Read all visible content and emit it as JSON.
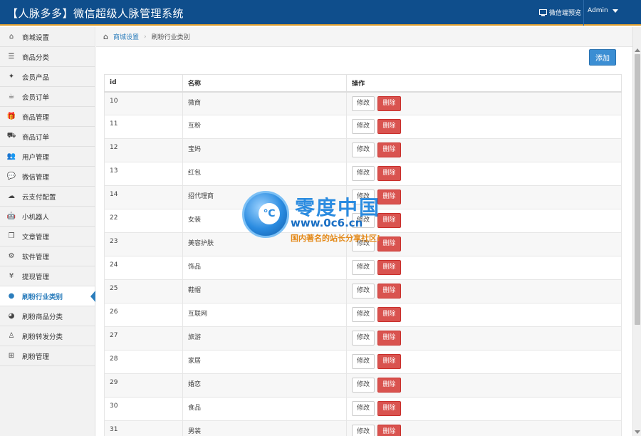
{
  "header": {
    "title": "【人脉多多】微信超级人脉管理系统",
    "preview_label": "微信端预览",
    "user": "Admin"
  },
  "sidebar": {
    "items": [
      {
        "label": "商城设置",
        "icon": "home-icon",
        "glyph": "⌂"
      },
      {
        "label": "商品分类",
        "icon": "list-icon",
        "glyph": "☰"
      },
      {
        "label": "会员产品",
        "icon": "twitter-icon",
        "glyph": "✦"
      },
      {
        "label": "会员订单",
        "icon": "coffee-icon",
        "glyph": "☕"
      },
      {
        "label": "商品管理",
        "icon": "gift-icon",
        "glyph": "🎁"
      },
      {
        "label": "商品订单",
        "icon": "truck-icon",
        "glyph": "⛟"
      },
      {
        "label": "用户管理",
        "icon": "users-icon",
        "glyph": "👥"
      },
      {
        "label": "微信管理",
        "icon": "comments-icon",
        "glyph": "💬"
      },
      {
        "label": "云支付配置",
        "icon": "cloud-icon",
        "glyph": "☁"
      },
      {
        "label": "小机器人",
        "icon": "android-icon",
        "glyph": "🤖"
      },
      {
        "label": "文章管理",
        "icon": "copy-icon",
        "glyph": "❐"
      },
      {
        "label": "软件管理",
        "icon": "cogs-icon",
        "glyph": "⚙"
      },
      {
        "label": "提现管理",
        "icon": "yen-icon",
        "glyph": "¥"
      },
      {
        "label": "刷粉行业类别",
        "icon": "github-icon",
        "glyph": "●"
      },
      {
        "label": "刷粉商品分类",
        "icon": "github-alt-icon",
        "glyph": "◕"
      },
      {
        "label": "刷粉转发分类",
        "icon": "linux-icon",
        "glyph": "♙"
      },
      {
        "label": "刷粉管理",
        "icon": "sitemap-icon",
        "glyph": "⊞"
      }
    ],
    "active_index": 13
  },
  "breadcrumb": {
    "parent": "商城设置",
    "current": "刷粉行业类别"
  },
  "toolbar": {
    "add_label": "添加"
  },
  "table": {
    "headers": [
      "id",
      "名称",
      "操作"
    ],
    "edit_label": "修改",
    "delete_label": "删除",
    "rows": [
      {
        "id": "10",
        "name": "微商"
      },
      {
        "id": "11",
        "name": "互粉"
      },
      {
        "id": "12",
        "name": "宝妈"
      },
      {
        "id": "13",
        "name": "红包"
      },
      {
        "id": "14",
        "name": "招代理商"
      },
      {
        "id": "22",
        "name": "女装"
      },
      {
        "id": "23",
        "name": "美容护肤"
      },
      {
        "id": "24",
        "name": "饰品"
      },
      {
        "id": "25",
        "name": "鞋帽"
      },
      {
        "id": "26",
        "name": "互联网"
      },
      {
        "id": "27",
        "name": "旅游"
      },
      {
        "id": "28",
        "name": "家居"
      },
      {
        "id": "29",
        "name": "婚恋"
      },
      {
        "id": "30",
        "name": "食品"
      },
      {
        "id": "31",
        "name": "男装"
      }
    ]
  },
  "watermark": {
    "badge": "℃",
    "title": "零度中国",
    "url": "www.0c6.cn",
    "slogan": "国内著名的站长分享社区!"
  },
  "colors": {
    "header_bg": "#0f4e8c",
    "accent": "#2b7dbc",
    "add_button": "#3b8ed3",
    "delete_button": "#d9534f"
  }
}
